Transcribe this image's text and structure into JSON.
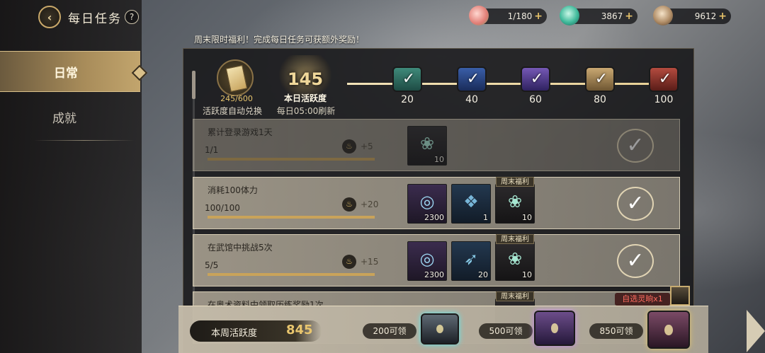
{
  "header": {
    "back_icon": "back-arrow-icon",
    "title": "每日任务",
    "help_label": "?"
  },
  "resources": [
    {
      "icon": "peach-icon",
      "value": "1/180",
      "plus": "+"
    },
    {
      "icon": "jade-icon",
      "value": "3867",
      "plus": "+"
    },
    {
      "icon": "coin-icon",
      "value": "9612",
      "plus": "+"
    }
  ],
  "sidebar": {
    "items": [
      {
        "label": "日常",
        "active": true
      },
      {
        "label": "成就",
        "active": false
      }
    ]
  },
  "banner": "周末限时福利！完成每日任务可获额外奖励！",
  "activity": {
    "card_count": "245/600",
    "card_label": "活跃度自动兑换",
    "value": "145",
    "title": "本日活跃度",
    "reset": "每日05:00刷新",
    "chests": [
      {
        "value": "20",
        "claimed": true,
        "color": "#3f8a7a"
      },
      {
        "value": "40",
        "claimed": true,
        "color": "#3a5ea8"
      },
      {
        "value": "60",
        "claimed": true,
        "color": "#7558b5"
      },
      {
        "value": "80",
        "claimed": true,
        "color": "#c9a872"
      },
      {
        "value": "100",
        "claimed": true,
        "color": "#b44b3f"
      }
    ]
  },
  "tasks": [
    {
      "title": "累计登录游戏1天",
      "progress": "1/1",
      "fill": 1.0,
      "points": "+5",
      "rewards": [
        {
          "qty": "10",
          "tag": "",
          "style": "rw-dark",
          "icon": "lotus-icon"
        }
      ],
      "completed": true
    },
    {
      "title": "消耗100体力",
      "progress": "100/100",
      "fill": 1.0,
      "points": "+20",
      "rewards": [
        {
          "qty": "2300",
          "tag": "",
          "style": "rw-purple",
          "icon": "coin-bundle-icon"
        },
        {
          "qty": "1",
          "tag": "",
          "style": "rw-blue",
          "icon": "crystal-icon"
        },
        {
          "qty": "10",
          "tag": "周末福利",
          "style": "rw-dark",
          "icon": "lotus-icon"
        }
      ],
      "completed": false
    },
    {
      "title": "在武馆中挑战5次",
      "progress": "5/5",
      "fill": 1.0,
      "points": "+15",
      "rewards": [
        {
          "qty": "2300",
          "tag": "",
          "style": "rw-purple",
          "icon": "coin-bundle-icon"
        },
        {
          "qty": "20",
          "tag": "",
          "style": "rw-blue",
          "icon": "feather-icon"
        },
        {
          "qty": "10",
          "tag": "周末福利",
          "style": "rw-dark",
          "icon": "lotus-icon"
        }
      ],
      "completed": false
    },
    {
      "title": "在奥术资料中领取历练奖励1次",
      "progress": "",
      "fill": 0,
      "points": "",
      "rewards": [
        {
          "qty": "",
          "tag": "周末福利",
          "style": "rw-dark",
          "icon": "lotus-icon"
        }
      ],
      "completed": false
    }
  ],
  "weekly": {
    "label": "本周活跃度",
    "value": "845",
    "milestones": [
      {
        "label": "200可领"
      },
      {
        "label": "500可领"
      },
      {
        "label": "850可领"
      }
    ],
    "select_label": "自选灵晌x1"
  }
}
